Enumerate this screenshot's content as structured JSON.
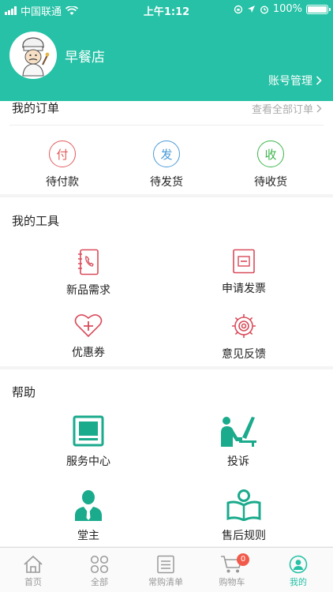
{
  "status_bar": {
    "carrier": "中国联通",
    "time": "上午1:12",
    "battery": "100%",
    "battery_level": 1.0
  },
  "header": {
    "shop_name": "早餐店",
    "account_label": "账号管理"
  },
  "orders": {
    "title": "我的订单",
    "view_all": "查看全部订单",
    "items": [
      {
        "glyph": "付",
        "label": "待付款",
        "color": "#e25b5b"
      },
      {
        "glyph": "发",
        "label": "待发货",
        "color": "#4a9ad6"
      },
      {
        "glyph": "收",
        "label": "待收货",
        "color": "#3bb54a"
      }
    ]
  },
  "tools": {
    "title": "我的工具",
    "items": [
      {
        "label": "新品需求",
        "icon": "phonebook-icon"
      },
      {
        "label": "申请发票",
        "icon": "invoice-icon"
      },
      {
        "label": "优惠券",
        "icon": "heart-plus-icon"
      },
      {
        "label": "意见反馈",
        "icon": "gear-icon"
      }
    ],
    "accent": "#d94b5a"
  },
  "help": {
    "title": "帮助",
    "items": [
      {
        "label": "服务中心",
        "icon": "monitor-icon"
      },
      {
        "label": "投诉",
        "icon": "person-at-desk-icon"
      },
      {
        "label": "堂主",
        "icon": "manager-icon"
      },
      {
        "label": "售后规则",
        "icon": "reading-icon"
      }
    ],
    "accent": "#1aaa8c"
  },
  "tabbar": {
    "tabs": [
      {
        "label": "首页",
        "icon": "home-icon"
      },
      {
        "label": "全部",
        "icon": "grid-icon"
      },
      {
        "label": "常购清单",
        "icon": "list-icon"
      },
      {
        "label": "购物车",
        "icon": "cart-icon",
        "badge": "0"
      },
      {
        "label": "我的",
        "icon": "profile-icon",
        "active": true
      }
    ]
  }
}
